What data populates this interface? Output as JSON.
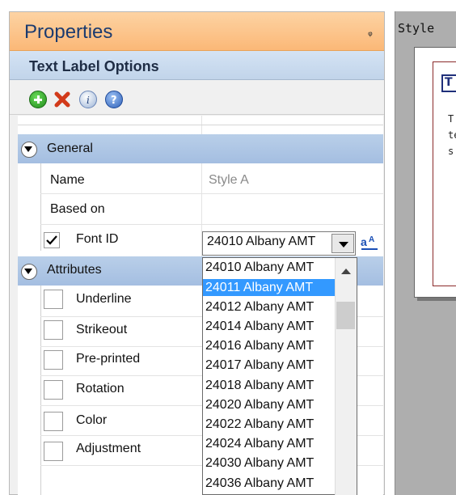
{
  "panel": {
    "title": "Properties",
    "pin_glyph": "ᵩ",
    "subtitle": "Text Label Options",
    "toolbar": {
      "add_icon": "add-icon",
      "delete_icon": "delete-icon",
      "info_icon": "info-icon",
      "help_icon": "help-icon"
    },
    "categories": {
      "general": "General",
      "attributes": "Attributes"
    },
    "general_rows": {
      "name_label": "Name",
      "name_value": "Style A",
      "based_on_label": "Based on",
      "font_id_label": "Font ID",
      "font_id_checked": true
    },
    "attribute_rows": [
      "Underline",
      "Strikeout",
      "Pre-printed",
      "Rotation",
      "Color",
      "Adjustment"
    ],
    "font_combo": {
      "selected": "24010 Albany AMT",
      "browse_icon": "font-browse-icon",
      "browse_glyph": "a",
      "options": [
        "24010 Albany AMT",
        "24011 Albany AMT",
        "24012 Albany AMT",
        "24014 Albany AMT",
        "24016 Albany AMT",
        "24017 Albany AMT",
        "24018 Albany AMT",
        "24020 Albany AMT",
        "24022 Albany AMT",
        "24024 Albany AMT",
        "24030 Albany AMT",
        "24036 Albany AMT"
      ],
      "highlighted_index": 1
    }
  },
  "canvas": {
    "title": "Style",
    "badge": "T",
    "text_lines": [
      "T",
      "te",
      "s"
    ]
  },
  "colors": {
    "header_orange": "#fbb877",
    "title_blue": "#1b3b6f",
    "category_blue": "#a4bee1",
    "selection_blue": "#3399ff"
  }
}
